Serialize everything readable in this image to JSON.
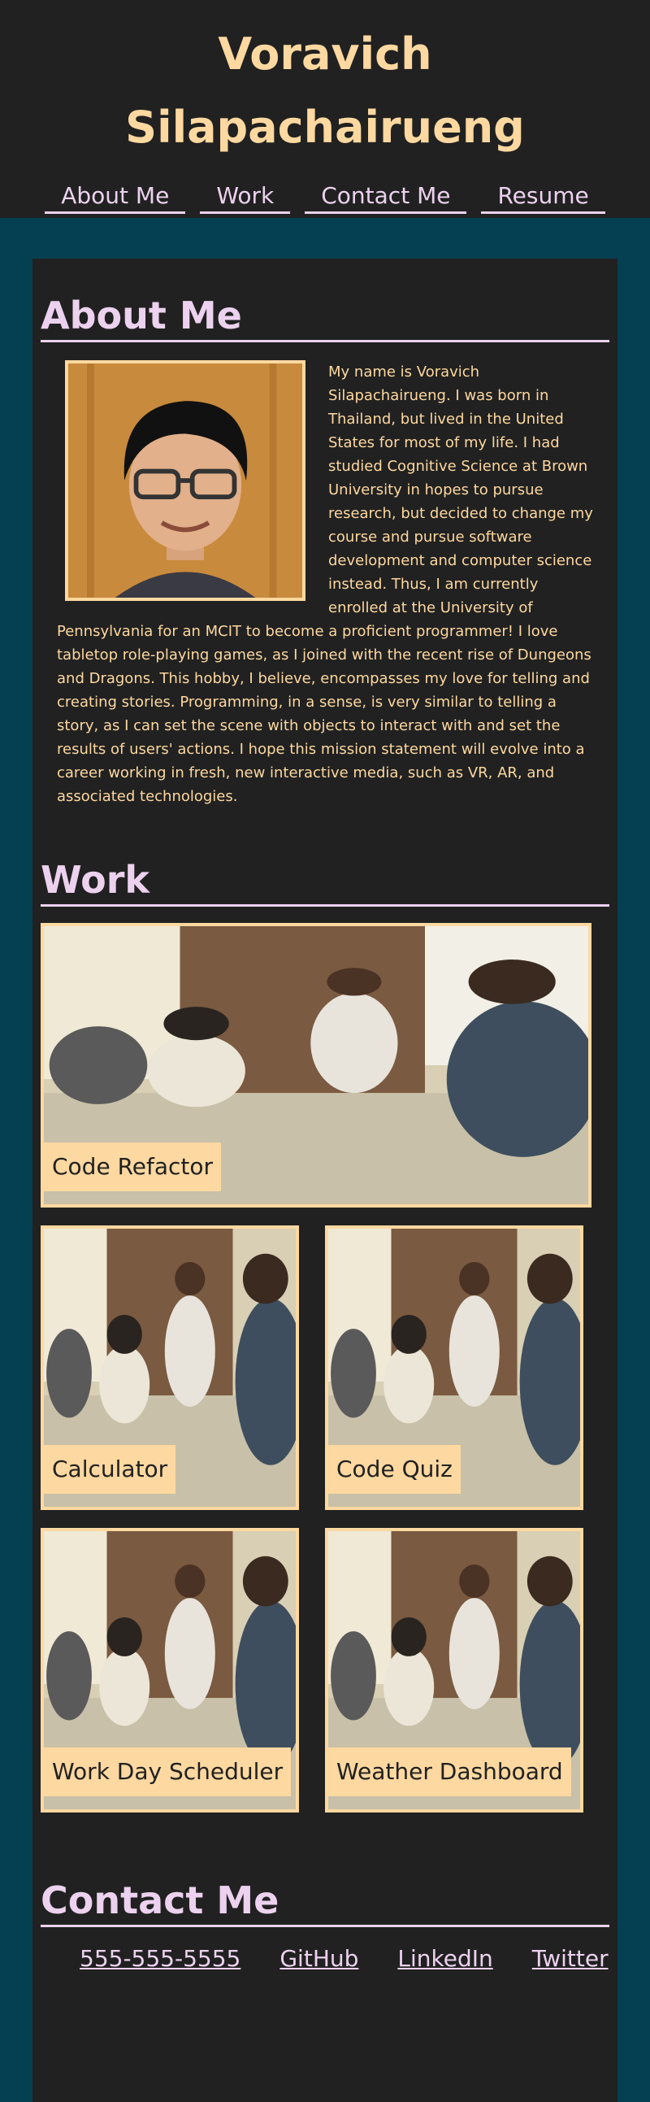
{
  "header": {
    "name_line1": "Voravich",
    "name_line2": "Silapachairueng",
    "nav": [
      "About Me",
      "Work",
      "Contact Me",
      "Resume"
    ]
  },
  "about": {
    "title": "About Me",
    "text": "My name is Voravich Silapachairueng. I was born in Thailand, but lived in the United States for most of my life. I had studied Cognitive Science at Brown University in hopes to pursue research, but decided to change my course and pursue software development and computer science instead. Thus, I am currently enrolled at the University of Pennsylvania for an MCIT to become a proficient programmer! I love tabletop role-playing games, as I joined with the recent rise of Dungeons and Dragons. This hobby, I believe, encompasses my love for telling and creating stories. Programming, in a sense, is very similar to telling a story, as I can set the scene with objects to interact with and set the results of users' actions. I hope this mission statement will evolve into a career working in fresh, new interactive media, such as VR, AR, and associated technologies."
  },
  "work": {
    "title": "Work",
    "projects": [
      "Code Refactor",
      "Calculator",
      "Code Quiz",
      "Work Day Scheduler",
      "Weather Dashboard"
    ]
  },
  "contact": {
    "title": "Contact Me",
    "links": [
      "555-555-5555",
      "GitHub",
      "LinkedIn",
      "Twitter"
    ]
  },
  "colors": {
    "page_bg": "#053f52",
    "panel_bg": "#212121",
    "accent_peach": "#fdd8a0",
    "accent_lilac": "#ecd2ee"
  }
}
